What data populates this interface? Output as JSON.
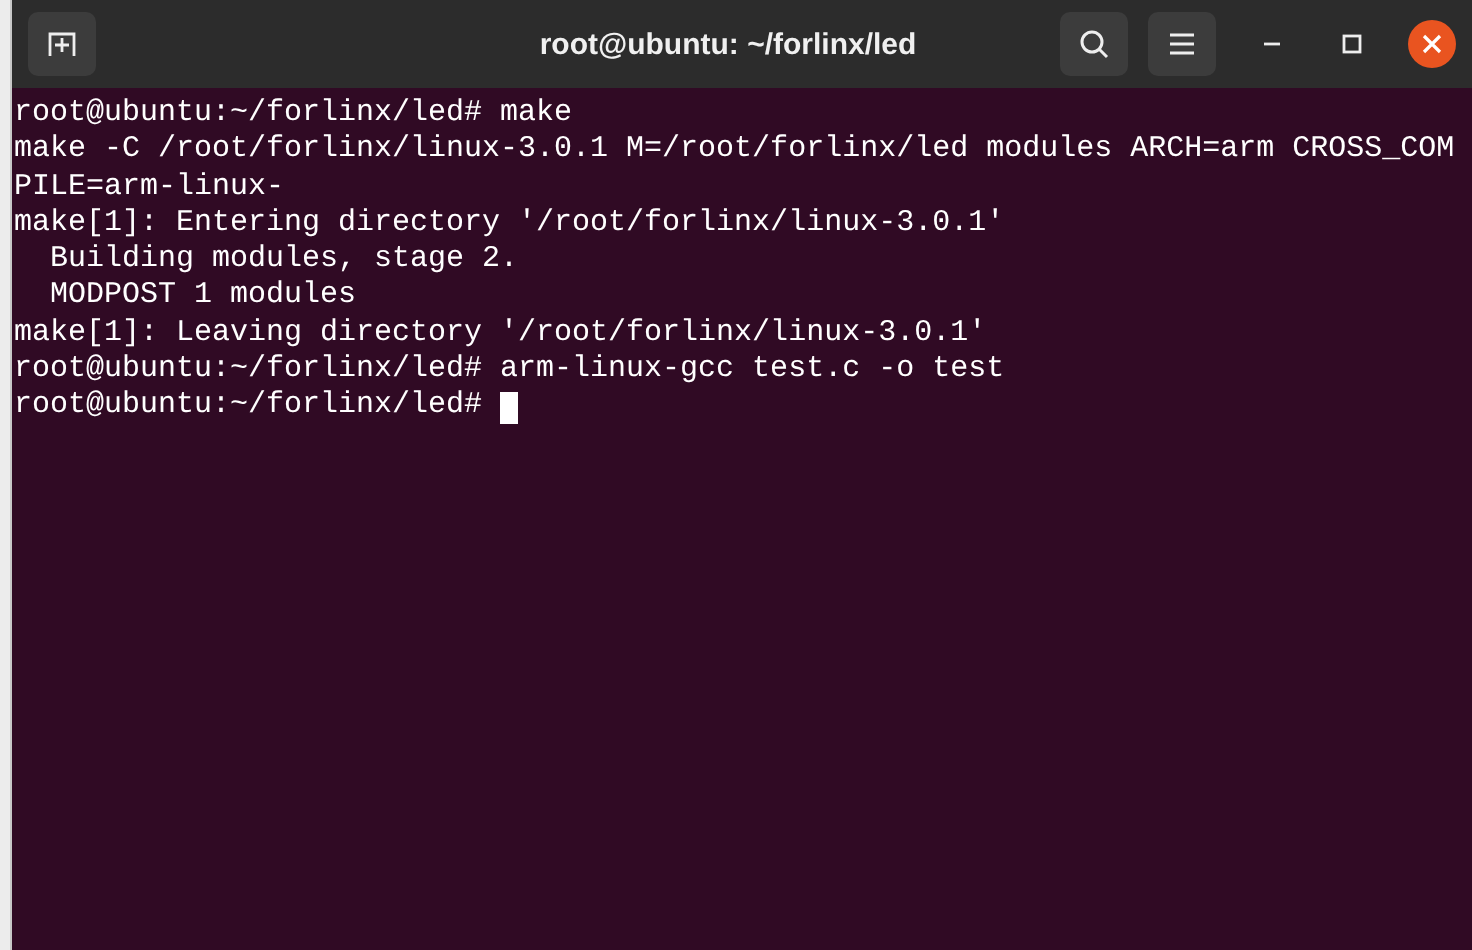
{
  "window": {
    "title": "root@ubuntu: ~/forlinx/led"
  },
  "terminal": {
    "lines": [
      "root@ubuntu:~/forlinx/led# make",
      "make -C /root/forlinx/linux-3.0.1 M=/root/forlinx/led modules ARCH=arm CROSS_COM",
      "PILE=arm-linux-",
      "make[1]: Entering directory '/root/forlinx/linux-3.0.1'",
      "  Building modules, stage 2.",
      "  MODPOST 1 modules",
      "make[1]: Leaving directory '/root/forlinx/linux-3.0.1'",
      "root@ubuntu:~/forlinx/led# arm-linux-gcc test.c -o test",
      "root@ubuntu:~/forlinx/led# "
    ],
    "cursor": true
  }
}
